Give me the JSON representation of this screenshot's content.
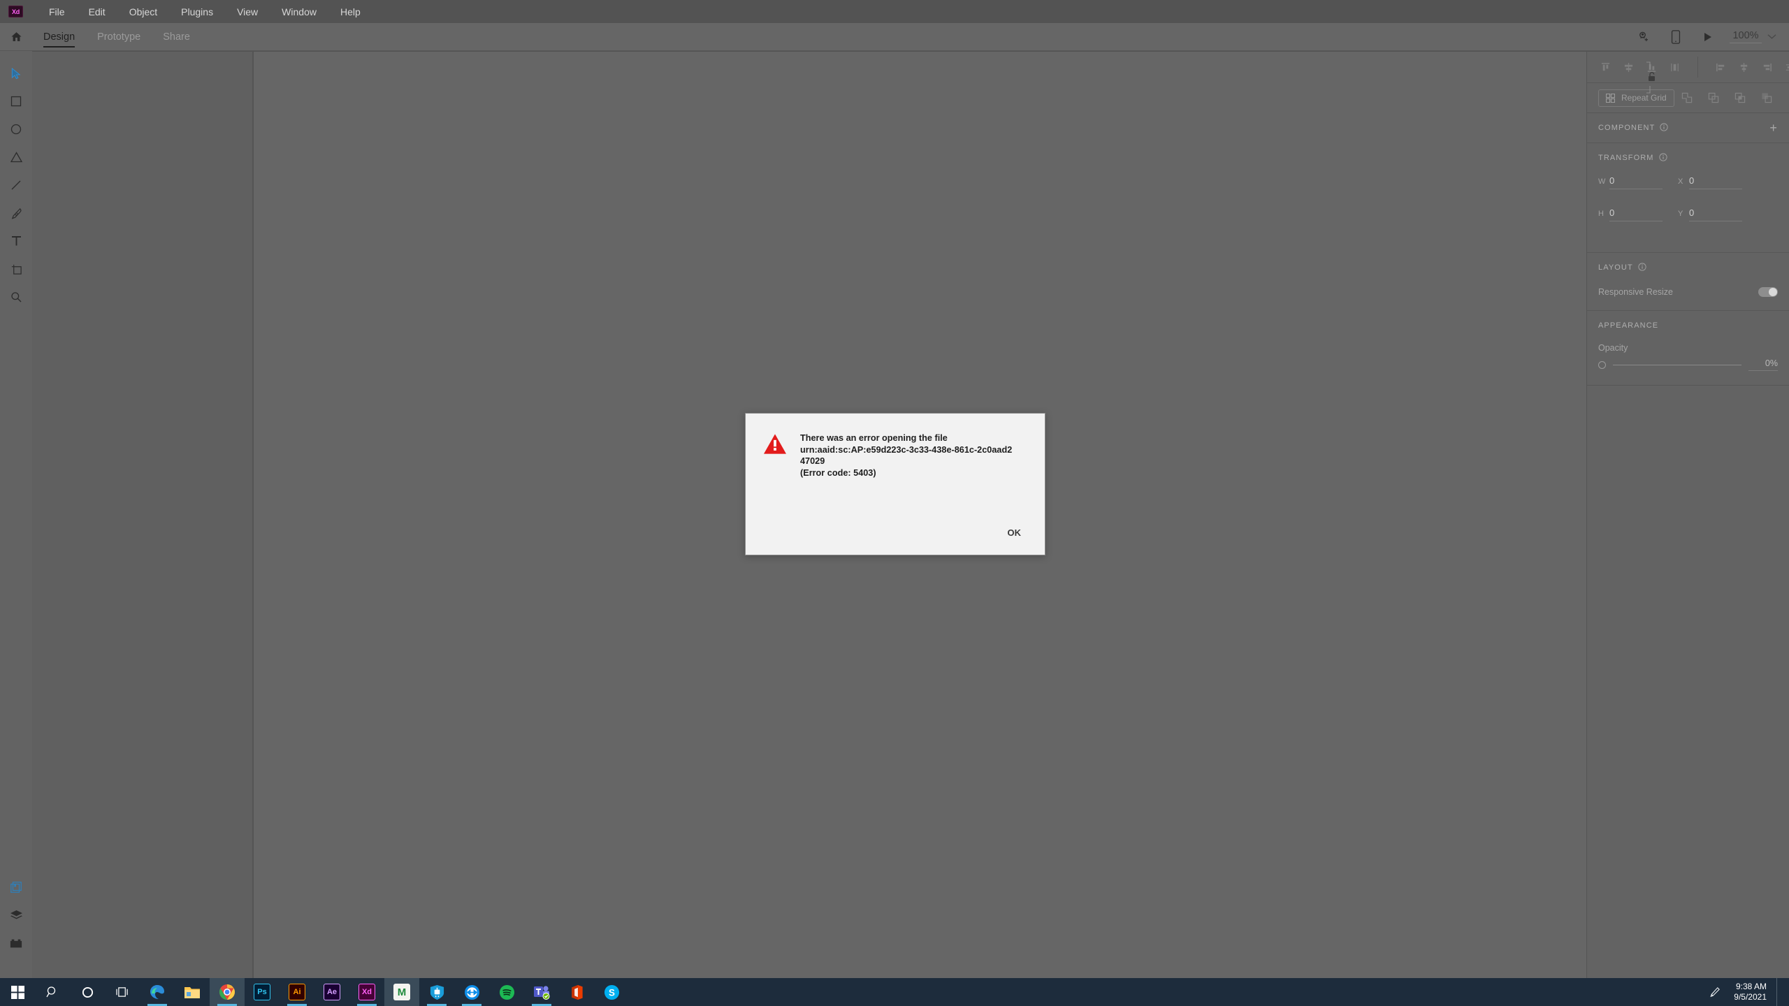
{
  "app": {
    "name": "Adobe XD",
    "logo_text": "Xd"
  },
  "menubar": {
    "items": [
      {
        "label": "File"
      },
      {
        "label": "Edit"
      },
      {
        "label": "Object"
      },
      {
        "label": "Plugins"
      },
      {
        "label": "View"
      },
      {
        "label": "Window"
      },
      {
        "label": "Help"
      }
    ]
  },
  "tabbar": {
    "home_icon": "home-icon",
    "tabs": [
      {
        "label": "Design",
        "active": true
      },
      {
        "label": "Prototype",
        "active": false
      },
      {
        "label": "Share",
        "active": false
      }
    ],
    "invite_icon": "invite-user-icon",
    "device_preview_icon": "mobile-device-icon",
    "play_icon": "play-icon",
    "zoom_value": "100%",
    "zoom_chevron": "chevron-down-icon"
  },
  "toolrail": {
    "tools": [
      {
        "name": "select-tool",
        "icon": "cursor-arrow-icon",
        "active": true
      },
      {
        "name": "rectangle-tool",
        "icon": "rectangle-icon",
        "active": false
      },
      {
        "name": "ellipse-tool",
        "icon": "ellipse-icon",
        "active": false
      },
      {
        "name": "polygon-tool",
        "icon": "triangle-icon",
        "active": false
      },
      {
        "name": "line-tool",
        "icon": "line-icon",
        "active": false
      },
      {
        "name": "pen-tool",
        "icon": "pen-nib-icon",
        "active": false
      },
      {
        "name": "text-tool",
        "icon": "text-T-icon",
        "active": false
      },
      {
        "name": "artboard-tool",
        "icon": "artboard-icon",
        "active": false
      },
      {
        "name": "zoom-tool",
        "icon": "magnifier-icon",
        "active": false
      }
    ],
    "bottom_tools": [
      {
        "name": "libraries-panel-button",
        "icon": "libraries-icon",
        "active": true
      },
      {
        "name": "layers-panel-button",
        "icon": "layers-icon",
        "active": false
      },
      {
        "name": "plugins-panel-button",
        "icon": "plugins-icon",
        "active": false
      }
    ]
  },
  "rightpanel": {
    "align_icons": [
      "align-top-icon",
      "align-horizontal-center-icon",
      "align-bottom-icon",
      "align-vertical-center-icon"
    ],
    "distribute_icons": [
      "align-left-icon",
      "distribute-vertical-icon",
      "align-right-icon",
      "distribute-horizontal-icon"
    ],
    "repeat_grid": {
      "label": "Repeat Grid",
      "icon": "repeat-grid-icon"
    },
    "boolean_icons": [
      "boolean-add-icon",
      "boolean-subtract-icon",
      "boolean-intersect-icon",
      "boolean-exclude-icon"
    ],
    "component": {
      "title": "COMPONENT",
      "info_icon": "info-icon",
      "add_icon": "plus-icon"
    },
    "transform": {
      "title": "TRANSFORM",
      "info_icon": "info-icon",
      "lock_icon": "lock-open-icon",
      "fields": [
        {
          "label": "W",
          "value": "0",
          "name": "width-input"
        },
        {
          "label": "X",
          "value": "0",
          "name": "x-position-input"
        },
        {
          "label": "H",
          "value": "0",
          "name": "height-input"
        },
        {
          "label": "Y",
          "value": "0",
          "name": "y-position-input"
        }
      ]
    },
    "layout": {
      "title": "LAYOUT",
      "info_icon": "info-icon",
      "responsive_resize_label": "Responsive Resize",
      "responsive_resize_on": true
    },
    "appearance": {
      "title": "APPEARANCE",
      "opacity_label": "Opacity",
      "opacity_value": "0%"
    }
  },
  "dialog": {
    "icon": "warning-triangle-icon",
    "message_line1": "There was an error opening the file",
    "message_line2": "urn:aaid:sc:AP:e59d223c-3c33-438e-861c-2c0aad247029",
    "message_line3": "(Error code: 5403)",
    "ok_label": "OK",
    "accent_color": "#e21b1b"
  },
  "taskbar": {
    "start_icon": "windows-start-icon",
    "search_icon": "search-icon",
    "cortana_icon": "cortana-circle-icon",
    "taskview_icon": "task-view-icon",
    "apps": [
      {
        "name": "edge-taskbar-icon",
        "label": "",
        "running": true,
        "focused": false
      },
      {
        "name": "file-explorer-taskbar-icon",
        "label": "",
        "running": false,
        "focused": false
      },
      {
        "name": "chrome-taskbar-icon",
        "label": "",
        "running": true,
        "focused": true
      },
      {
        "name": "photoshop-taskbar-icon",
        "label": "Ps",
        "running": false,
        "focused": false
      },
      {
        "name": "illustrator-taskbar-icon",
        "label": "Ai",
        "running": true,
        "focused": false
      },
      {
        "name": "aftereffects-taskbar-icon",
        "label": "Ae",
        "running": false,
        "focused": false
      },
      {
        "name": "xd-taskbar-icon",
        "label": "Xd",
        "running": true,
        "focused": false
      },
      {
        "name": "maya-taskbar-icon",
        "label": "M",
        "running": false,
        "focused": true
      },
      {
        "name": "gitkraken-taskbar-icon",
        "label": "",
        "running": true,
        "focused": false
      },
      {
        "name": "teamviewer-taskbar-icon",
        "label": "",
        "running": true,
        "focused": false
      },
      {
        "name": "spotify-taskbar-icon",
        "label": "",
        "running": false,
        "focused": false
      },
      {
        "name": "teams-taskbar-icon",
        "label": "T",
        "running": true,
        "focused": false
      },
      {
        "name": "office-taskbar-icon",
        "label": "",
        "running": false,
        "focused": false
      },
      {
        "name": "skype-taskbar-icon",
        "label": "S",
        "running": false,
        "focused": false
      }
    ],
    "tray": {
      "pen_icon": "pen-ink-icon",
      "time": "9:38 AM",
      "date": "9/5/2021"
    }
  }
}
